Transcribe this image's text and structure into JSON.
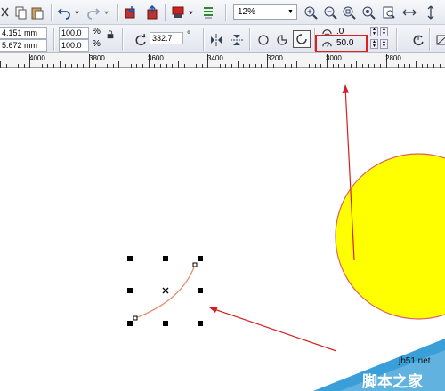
{
  "toolbar": {
    "zoom_value": "12%",
    "icons": [
      "cut-icon",
      "copy-icon",
      "paste-icon",
      "undo-icon",
      "redo-icon",
      "import-icon",
      "export-icon",
      "publish-icon",
      "launcher-icon",
      "zoom-in-icon",
      "zoom-out-icon",
      "zoom-selected-icon",
      "zoom-all-icon",
      "zoom-page-icon",
      "zoom-width-icon",
      "zoom-height-icon"
    ]
  },
  "property_bar": {
    "pos_x": "4.151 mm",
    "pos_y": "5.672 mm",
    "scale_x": "100.0",
    "scale_y": "100.0",
    "percent": "%",
    "rotation": "332.7",
    "degree": "°",
    "start_angle": ".0",
    "end_angle": "50.0"
  },
  "ruler": {
    "labels": [
      "4000",
      "3800",
      "3600",
      "3400",
      "3200",
      "3000",
      "2800"
    ]
  },
  "canvas": {
    "circle_fill": "#ffff00",
    "circle_stroke": "#e06060",
    "arc_stroke": "#e88a6a",
    "annotation_color": "#d42020",
    "highlight_color": "#e02020"
  },
  "watermark": {
    "site": "jb51.net",
    "text": "脚本之家"
  }
}
